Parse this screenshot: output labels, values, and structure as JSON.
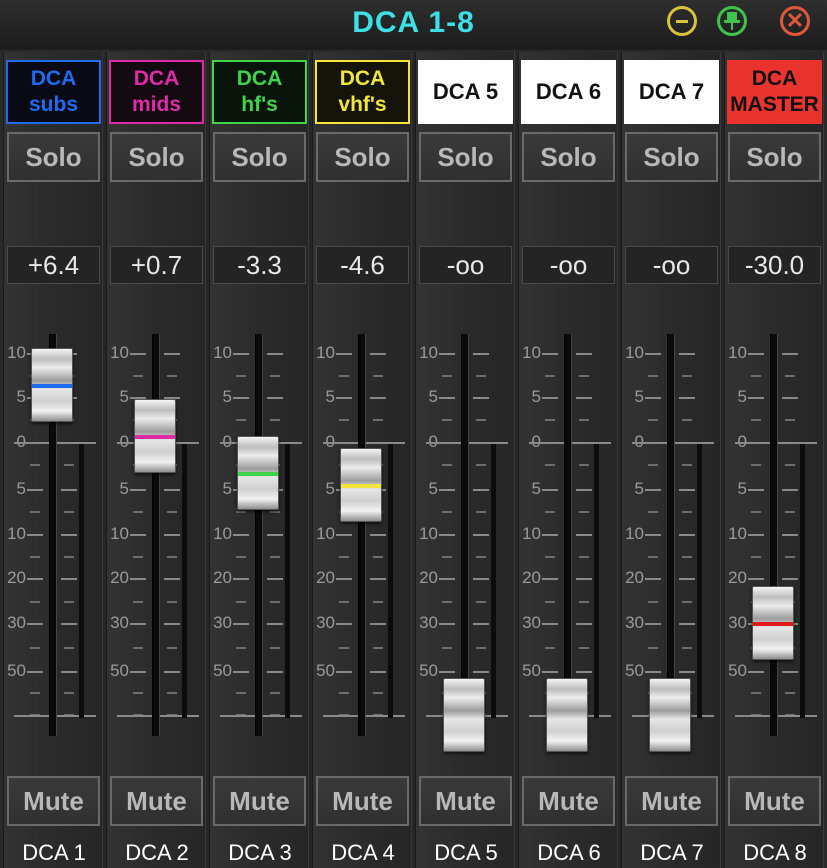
{
  "window": {
    "title": "DCA 1-8",
    "buttons": [
      {
        "name": "minimize",
        "icon": "minus-circle-icon",
        "color": "#d9c43a"
      },
      {
        "name": "pin",
        "icon": "pin-circle-icon",
        "color": "#3fc44a"
      },
      {
        "name": "close",
        "icon": "close-circle-icon",
        "color": "#e0583a",
        "glyph": "✕"
      }
    ]
  },
  "scale_labels": [
    "10",
    "5",
    "0",
    "5",
    "10",
    "20",
    "30",
    "50"
  ],
  "strips": [
    {
      "label_lines": [
        "DCA",
        "subs"
      ],
      "label_color": "#1e6cf0",
      "label_bg": "#0a0a14",
      "border_color": "#1e6cf0",
      "solo": "Solo",
      "value": "+6.4",
      "fader_level": 6.4,
      "fader_line_color": "#1e6cf0",
      "mute": "Mute",
      "channel": "DCA 1"
    },
    {
      "label_lines": [
        "DCA",
        "mids"
      ],
      "label_color": "#e02ba6",
      "label_bg": "#140a12",
      "border_color": "#e02ba6",
      "solo": "Solo",
      "value": "+0.7",
      "fader_level": 0.7,
      "fader_line_color": "#e02ba6",
      "mute": "Mute",
      "channel": "DCA 2"
    },
    {
      "label_lines": [
        "DCA",
        "hf's"
      ],
      "label_color": "#3fd44a",
      "label_bg": "#0a140a",
      "border_color": "#3fd44a",
      "solo": "Solo",
      "value": "-3.3",
      "fader_level": -3.3,
      "fader_line_color": "#3fd44a",
      "mute": "Mute",
      "channel": "DCA 3"
    },
    {
      "label_lines": [
        "DCA",
        "vhf's"
      ],
      "label_color": "#f2e63a",
      "label_bg": "#14140a",
      "border_color": "#f2e63a",
      "solo": "Solo",
      "value": "-4.6",
      "fader_level": -4.6,
      "fader_line_color": "#f2e63a",
      "mute": "Mute",
      "channel": "DCA 4"
    },
    {
      "label_lines": [
        "DCA 5"
      ],
      "label_color": "#111111",
      "label_bg": "#ffffff",
      "border_color": "#ffffff",
      "solo": "Solo",
      "value": "-oo",
      "fader_level": "-inf",
      "fader_line_color": "",
      "mute": "Mute",
      "channel": "DCA 5"
    },
    {
      "label_lines": [
        "DCA 6"
      ],
      "label_color": "#111111",
      "label_bg": "#ffffff",
      "border_color": "#ffffff",
      "solo": "Solo",
      "value": "-oo",
      "fader_level": "-inf",
      "fader_line_color": "",
      "mute": "Mute",
      "channel": "DCA 6"
    },
    {
      "label_lines": [
        "DCA 7"
      ],
      "label_color": "#111111",
      "label_bg": "#ffffff",
      "border_color": "#ffffff",
      "solo": "Solo",
      "value": "-oo",
      "fader_level": "-inf",
      "fader_line_color": "",
      "mute": "Mute",
      "channel": "DCA 7"
    },
    {
      "label_lines": [
        "DCA",
        "MASTER"
      ],
      "label_color": "#111111",
      "label_bg": "#e8332e",
      "border_color": "#e8332e",
      "solo": "Solo",
      "value": "-30.0",
      "fader_level": -30.0,
      "fader_line_color": "#e01a1a",
      "mute": "Mute",
      "channel": "DCA 8"
    }
  ]
}
